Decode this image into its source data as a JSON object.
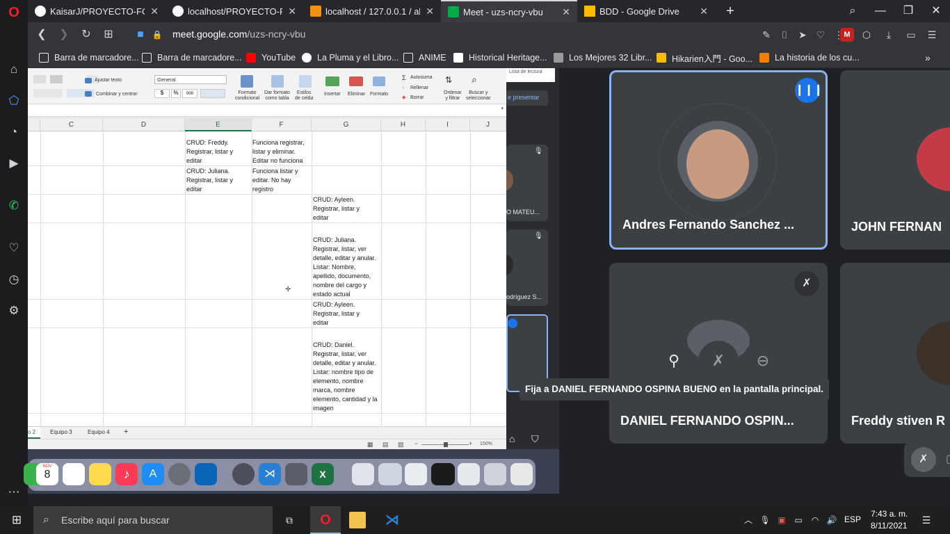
{
  "browser": {
    "tabs": [
      {
        "title": "KaisarJ/PROYECTO-FORMA",
        "favicon_color": "#ffffff"
      },
      {
        "title": "localhost/PROYECTO-FORM",
        "favicon_color": "#ffffff"
      },
      {
        "title": "localhost / 127.0.0.1 / alma",
        "favicon_color": "#f29111"
      },
      {
        "title": "Meet - uzs-ncry-vbu",
        "favicon_color": "#00ac47"
      },
      {
        "title": "BDD - Google Drive",
        "favicon_color": "#fbbc04"
      }
    ],
    "url_prefix": "meet.google.com",
    "url_path": "/uzs-ncry-vbu",
    "bookmarks": [
      {
        "label": "Barra de marcadore...",
        "icon": "folder-icon"
      },
      {
        "label": "Barra de marcadore...",
        "icon": "folder-icon"
      },
      {
        "label": "YouTube",
        "icon": "youtube-icon"
      },
      {
        "label": "La Pluma y el Libro...",
        "icon": "wordpress-icon"
      },
      {
        "label": "ANIME",
        "icon": "folder-icon"
      },
      {
        "label": "Historical Heritage...",
        "icon": "page-icon"
      },
      {
        "label": "Los Mejores 32 Libr...",
        "icon": "page-icon"
      },
      {
        "label": "Hikarien入門 - Goo...",
        "icon": "drive-icon"
      },
      {
        "label": "La historia de los cu...",
        "icon": "blogger-icon"
      }
    ]
  },
  "excel": {
    "ribbon": {
      "wrap_text": "Ajustar texto",
      "merge_center": "Combinar y centrar",
      "number_format": "General",
      "currency": "$",
      "percent": "%",
      "thousands": "000",
      "conditional_format": "Formato\ncondicional",
      "table_format": "Dar formato\ncomo tabla",
      "cell_styles": "Estilos\nde celda",
      "insert": "Insertar",
      "delete": "Eliminar",
      "format": "Formato",
      "autosum": "Autosuma",
      "fill": "Rellenar",
      "clear": "Borrar",
      "sort_filter": "Ordenar\ny filtrar",
      "find_select": "Buscar y\nseleccionar"
    },
    "columns": [
      "C",
      "D",
      "E",
      "F",
      "G",
      "H",
      "I",
      "J"
    ],
    "selected_column": "E",
    "cells": {
      "e1": "CRUD: Freddy.\nRegistrar, listar y\neditar",
      "f1": "Funciona registrar,\nlistar y eliminar.\nEditar no funciona",
      "e2": "CRUD: Juliana.\nRegistrar, listar y\neditar",
      "f2": "Funciona listar y\neditar. No hay\nregistro",
      "g3": "CRUD: Ayleen.\nRegistrar, listar y\neditar",
      "g4": "CRUD: Juliana.\nRegistrar, listar, ver\ndetalle, editar y anular.\nListar: Nombre,\napellido, documento,\nnombre del cargo y\nestado actual",
      "g5": "CRUD: Ayleen.\nRegistrar, listar y\neditar",
      "g6": "CRUD: Daniel.\nRegistrar, listar, ver\ndetalle, editar y anular.\nListar: nombre tipo de\nelemento, nombre\nmarca,  nombre\nelemento, cantidad y la\nimagen"
    },
    "sheet_tabs": [
      "o 2",
      "Equipo 3",
      "Equipo 4"
    ],
    "zoom": "150%"
  },
  "meet": {
    "overlay_labels": {
      "reading_list": "Lista de lectura",
      "present": "e presentar",
      "mini_name_1": "O MATEU...",
      "mini_name_2": "odríguez S..."
    },
    "participants": [
      {
        "name": "Andres Fernando Sanchez ...",
        "speaking": true
      },
      {
        "name": "JOHN FERNAN",
        "speaking": false
      },
      {
        "name": "DANIEL FERNANDO OSPIN...",
        "muted": true
      },
      {
        "name": "Freddy stiven R",
        "muted": false
      }
    ],
    "tooltip": "Fija a DANIEL FERNANDO OSPINA BUENO en la pantalla principal."
  },
  "taskbar": {
    "search_placeholder": "Escribe aquí para buscar",
    "language": "ESP",
    "time": "7:43 a. m.",
    "date": "8/11/2021"
  },
  "dock": {
    "calendar_month": "NOV",
    "calendar_day": "8"
  }
}
